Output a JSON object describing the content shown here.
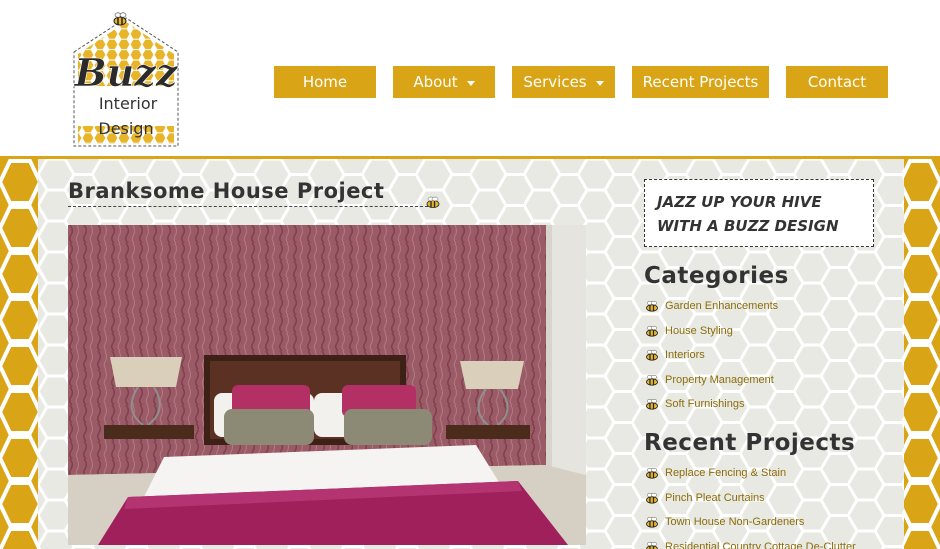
{
  "brand": {
    "logo_name": "Buzz",
    "logo_line1": "Interior",
    "logo_line2": "Design"
  },
  "nav": {
    "items": [
      {
        "label": "Home",
        "dropdown": false
      },
      {
        "label": "About",
        "dropdown": true
      },
      {
        "label": "Services",
        "dropdown": true
      },
      {
        "label": "Recent Projects",
        "dropdown": false
      },
      {
        "label": "Contact",
        "dropdown": false
      }
    ]
  },
  "post": {
    "title": "Branksome House Project"
  },
  "sidebar": {
    "slogan_line1": "JAZZ UP YOUR HIVE",
    "slogan_line2": "WITH A BUZZ DESIGN",
    "categories_title": "Categories",
    "categories": [
      "Garden Enhancements",
      "House Styling",
      "Interiors",
      "Property Management",
      "Soft Furnishings"
    ],
    "recent_title": "Recent Projects",
    "recent": [
      "Replace Fencing & Stain",
      "Pinch Pleat Curtains",
      "Town House Non-Gardeners",
      "Residential Country Cottage De-Clutter"
    ]
  },
  "colors": {
    "accent": "#d9a517",
    "panel": "#e9e9e3",
    "link": "#8a6d0b",
    "text": "#333333"
  }
}
